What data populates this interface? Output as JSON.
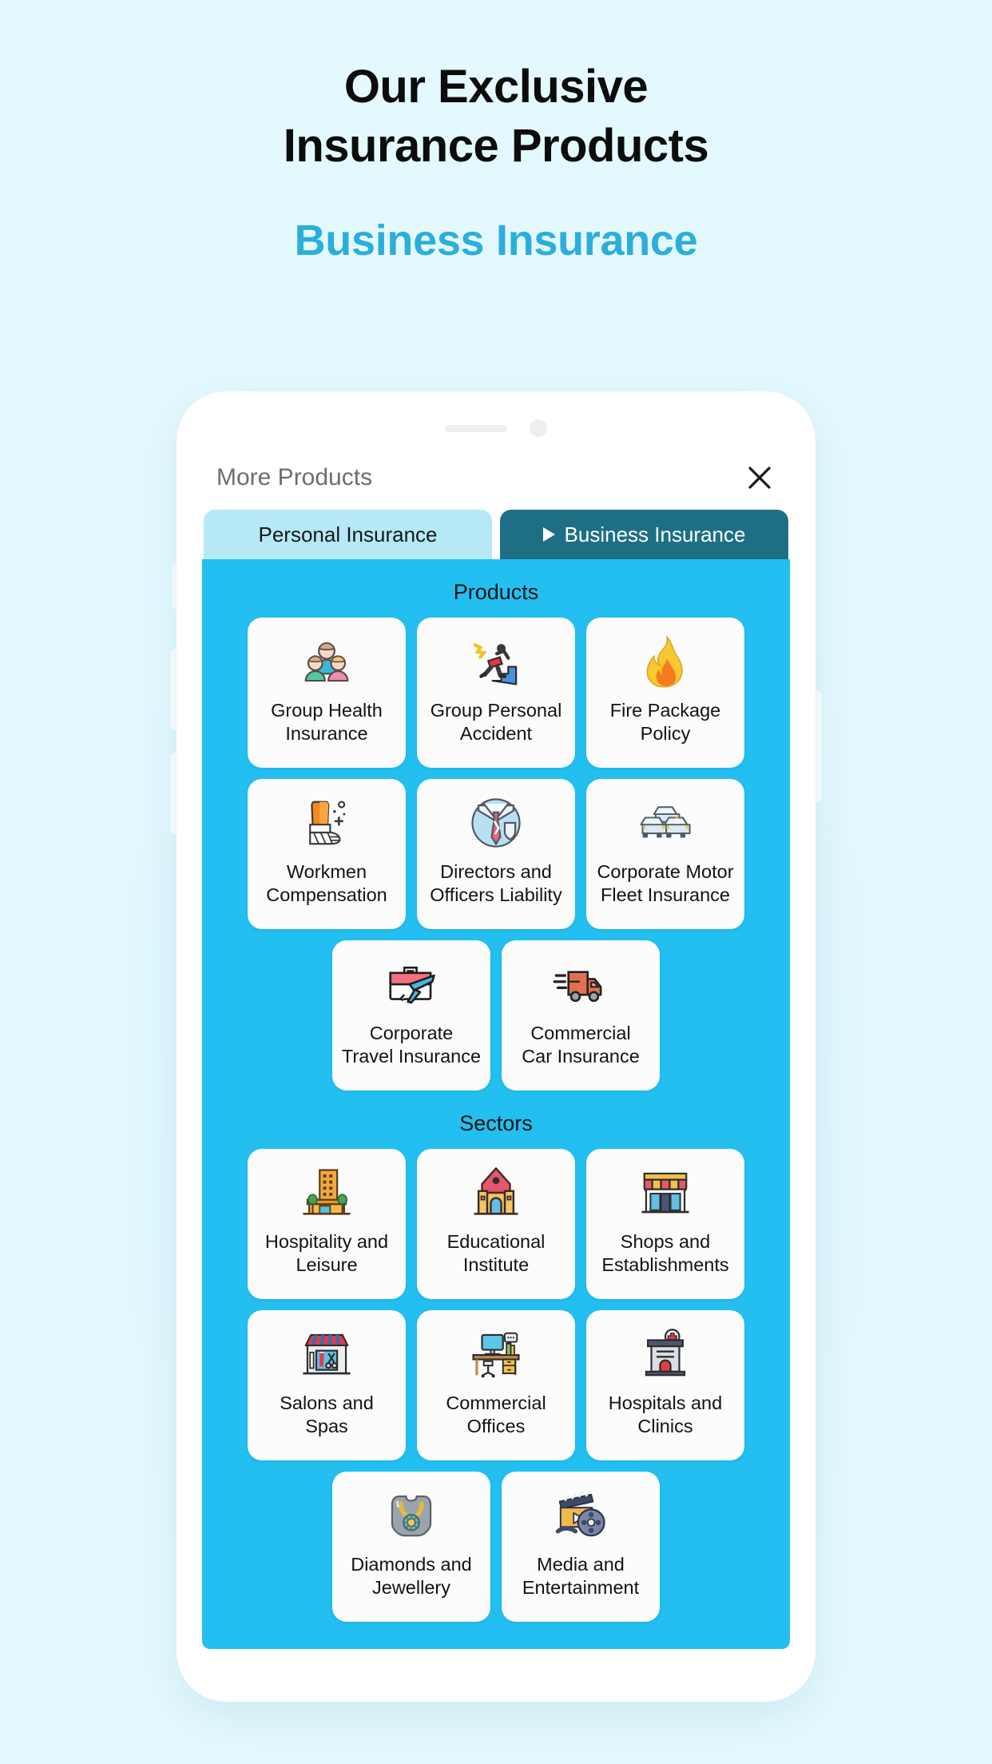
{
  "heading": {
    "line1": "Our Exclusive",
    "line2": "Insurance Products",
    "subtitle": "Business Insurance",
    "subtitle_color": "#2BAEDC",
    "title_color": "#0C0C0C"
  },
  "colors": {
    "page_background": "#E2F8FE",
    "panel_blue": "#22BFF0",
    "tab_active": "#1E6F84",
    "tab_inactive": "#B6E8F6",
    "card_white": "#FCFCFC"
  },
  "phone": {
    "speaker_icon": "speaker-grille",
    "camera_icon": "front-camera-dot",
    "buttons": [
      "mute-switch",
      "volume-up",
      "volume-down",
      "power"
    ]
  },
  "sheet": {
    "title": "More Products",
    "close_icon": "close-icon"
  },
  "tabs": [
    {
      "label": "Personal Insurance",
      "active": false,
      "icon": ""
    },
    {
      "label": "Business Insurance",
      "active": true,
      "icon": "play-triangle-icon"
    }
  ],
  "sections": [
    {
      "title": "Products",
      "rows": [
        [
          {
            "label": "Group Health\nInsurance",
            "icon": "family-group-icon"
          },
          {
            "label": "Group Personal\nAccident",
            "icon": "person-falling-stairs-icon"
          },
          {
            "label": "Fire Package\nPolicy",
            "icon": "flame-icon"
          }
        ],
        [
          {
            "label": "Workmen\nCompensation",
            "icon": "bandaged-arm-icon"
          },
          {
            "label": "Directors and\nOfficers Liability",
            "icon": "shirt-tie-shield-icon"
          },
          {
            "label": "Corporate Motor\nFleet Insurance",
            "icon": "car-fleet-icon"
          }
        ],
        [
          {
            "label": "Corporate\nTravel Insurance",
            "icon": "briefcase-airplane-icon"
          },
          {
            "label": "Commercial\nCar Insurance",
            "icon": "delivery-truck-icon"
          }
        ]
      ]
    },
    {
      "title": "Sectors",
      "rows": [
        [
          {
            "label": "Hospitality and\nLeisure",
            "icon": "hotel-building-icon"
          },
          {
            "label": "Educational\nInstitute",
            "icon": "school-building-icon"
          },
          {
            "label": "Shops and\nEstablishments",
            "icon": "shop-storefront-icon"
          }
        ],
        [
          {
            "label": "Salons and\nSpas",
            "icon": "salon-scissors-shop-icon"
          },
          {
            "label": "Commercial\nOffices",
            "icon": "office-desk-computer-icon"
          },
          {
            "label": "Hospitals and\nClinics",
            "icon": "hospital-building-icon"
          }
        ],
        [
          {
            "label": "Diamonds and\nJewellery",
            "icon": "necklace-icon"
          },
          {
            "label": "Media and\nEntertainment",
            "icon": "clapperboard-film-reel-icon"
          }
        ]
      ]
    }
  ]
}
